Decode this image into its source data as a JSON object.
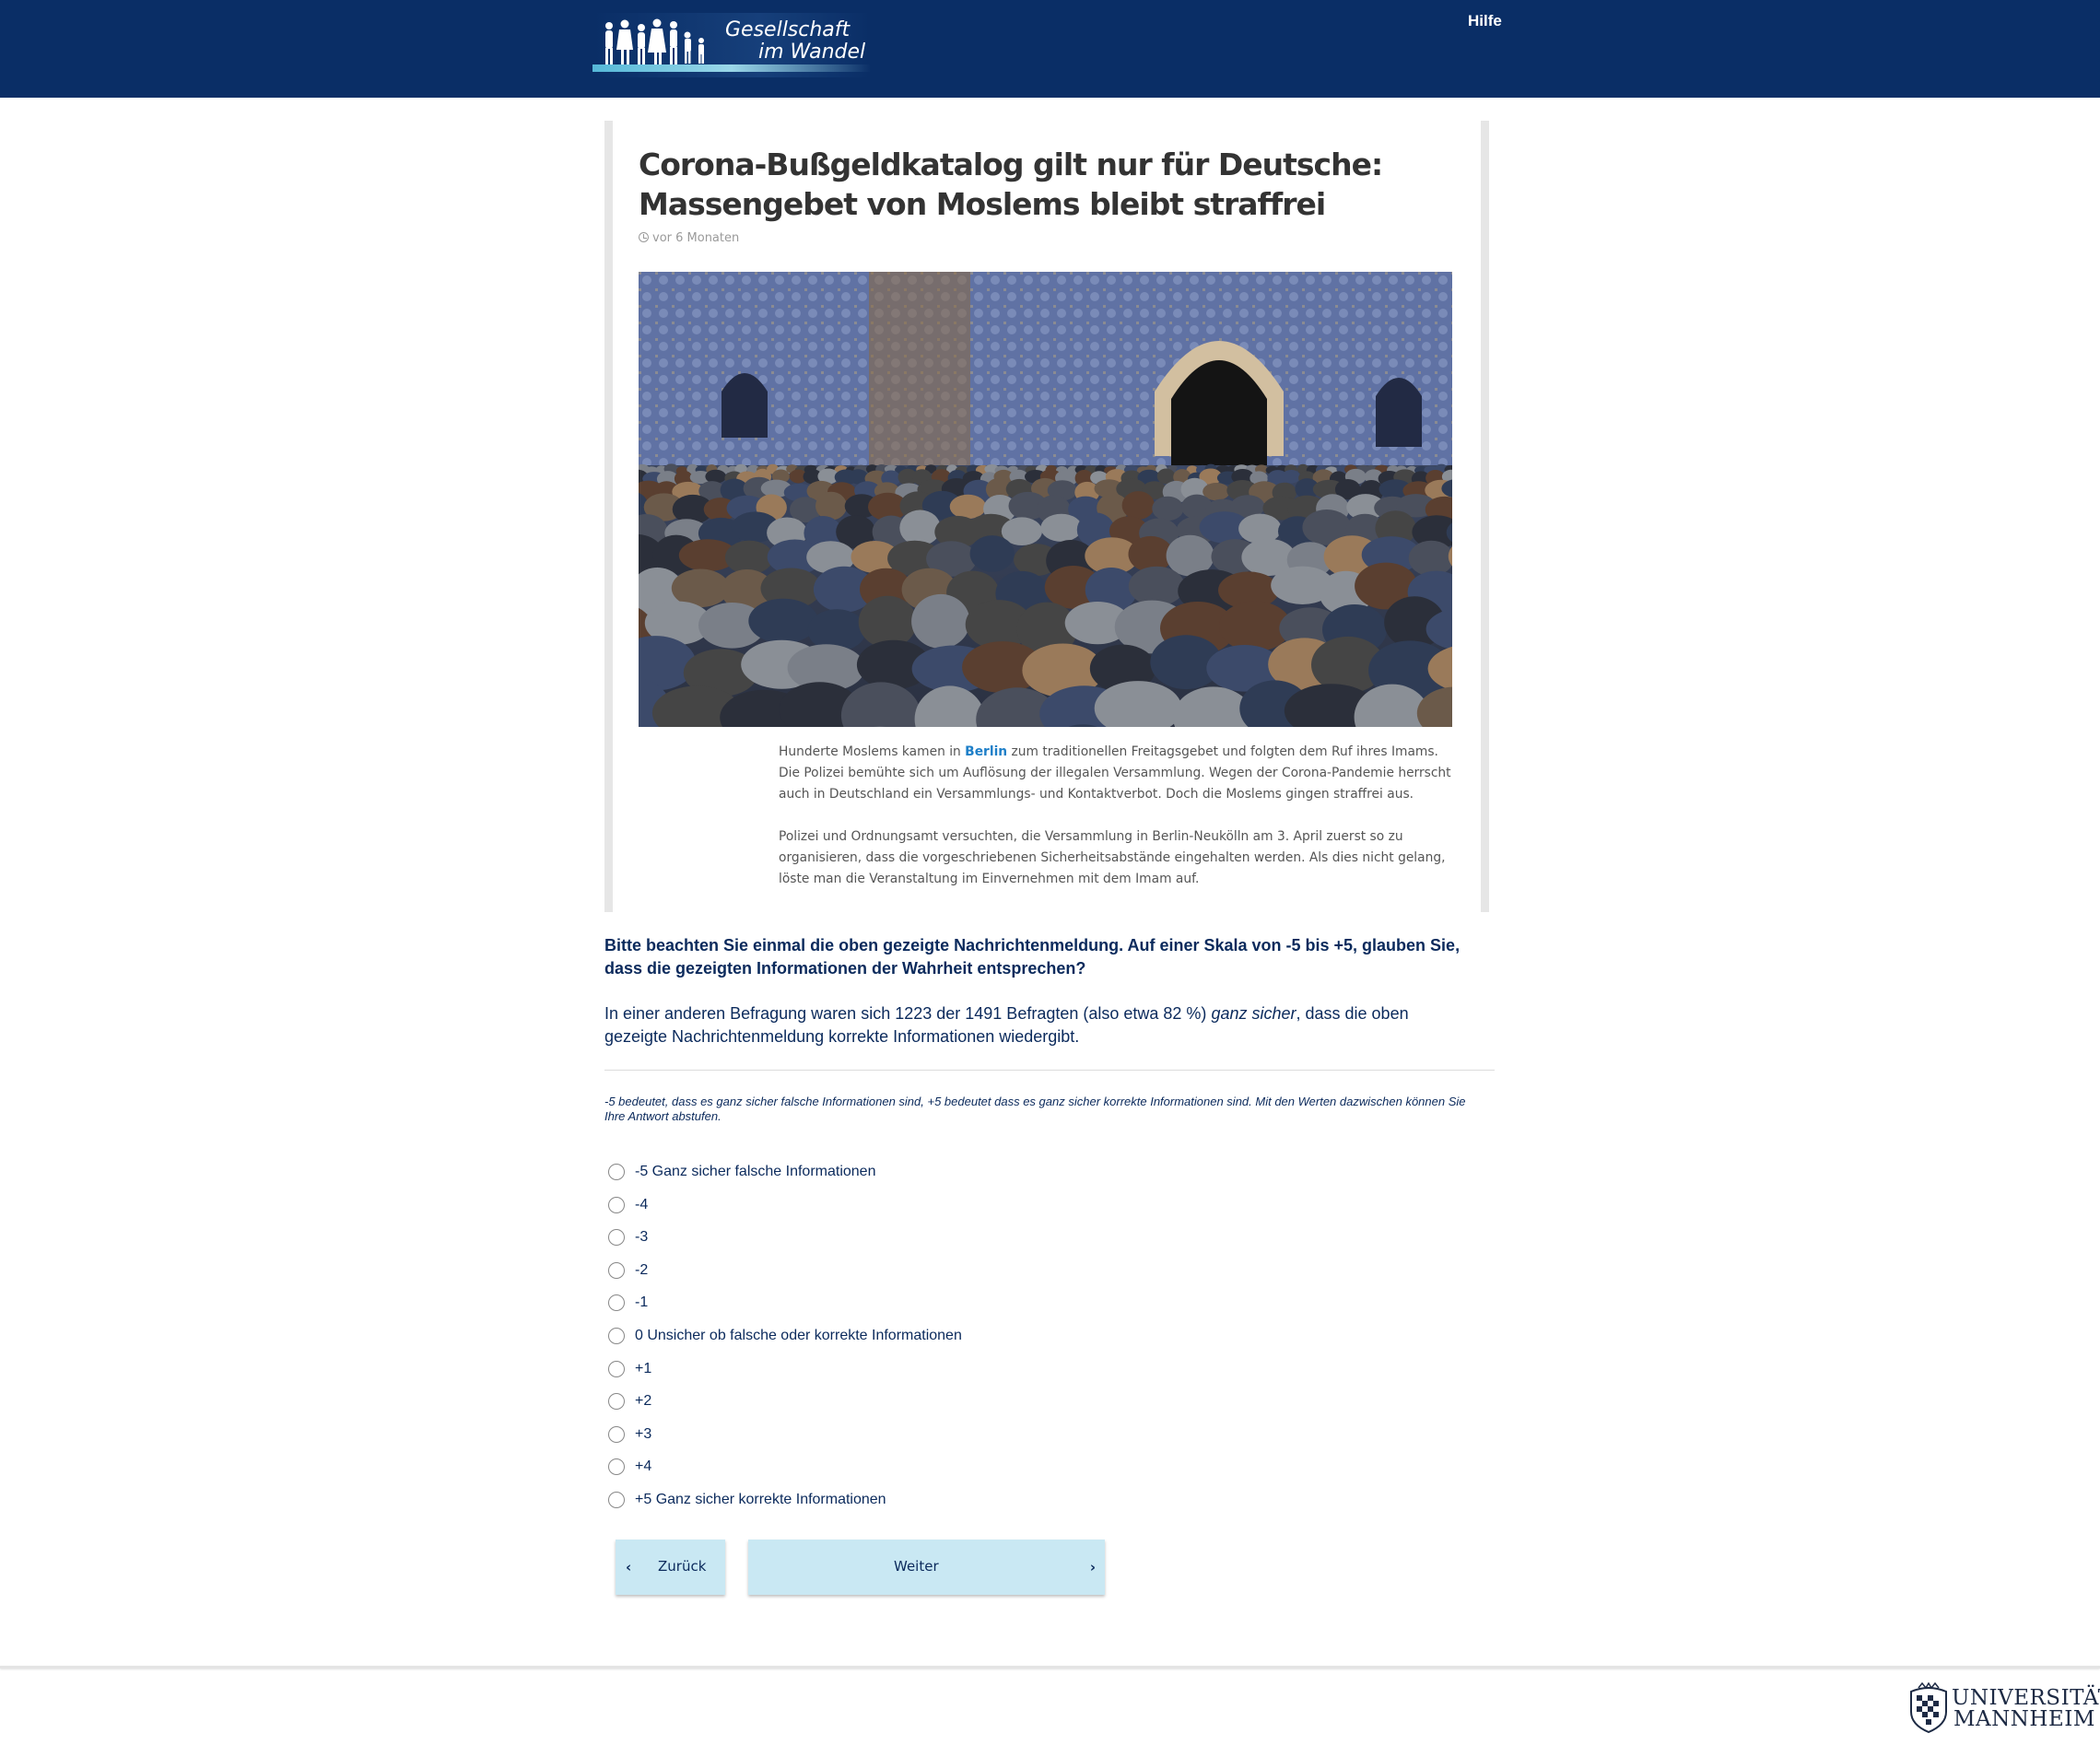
{
  "header": {
    "logo_line1": "Gesellschaft",
    "logo_line2": "im Wandel",
    "help_link": "Hilfe"
  },
  "article": {
    "title_line1": "Corona-Bußgeldkatalog gilt nur für Deutsche:",
    "title_line2": "Massengebet von Moslems bleibt straffrei",
    "date": "vor 6 Monaten",
    "photo_icon": "mass-prayer-mosque-photo",
    "p1_before": "Hunderte Moslems kamen in ",
    "p1_link": "Berlin",
    "p1_after": " zum traditionellen Freitagsgebet und folgten dem Ruf ihres Imams. Die Polizei bemühte sich um Auflösung der illegalen Versammlung. Wegen der Corona-Pandemie herrscht auch in Deutschland ein Versammlungs- und Kontaktverbot. Doch die Moslems gingen straffrei aus.",
    "p2": "Polizei und Ordnungsamt versuchten, die Versammlung in Berlin-Neukölln am 3. April zuerst so zu organisieren, dass die vorgeschriebenen Sicherheitsabstände eingehalten werden. Als dies nicht gelang, löste man die Veranstaltung im Einvernehmen mit dem Imam auf."
  },
  "question": {
    "text": "Bitte beachten Sie einmal die oben gezeigte Nachrichtenmeldung. Auf einer Skala von -5 bis +5, glauben Sie, dass die gezeigten Informationen der Wahrheit entsprechen?",
    "info_before": "In einer anderen Befragung waren sich 1223 der 1491 Befragten (also etwa 82 %) ",
    "info_emph": "ganz sicher",
    "info_after": ", dass die oben gezeigte Nachrichtenmeldung korrekte Informationen wiedergibt.",
    "hint": "-5 bedeutet, dass es ganz sicher falsche Informationen sind, +5 bedeutet dass es ganz sicher korrekte Informationen sind. Mit den Werten dazwischen können Sie Ihre Antwort abstufen."
  },
  "options": [
    {
      "label": "-5 Ganz sicher falsche Informationen"
    },
    {
      "label": "-4"
    },
    {
      "label": "-3"
    },
    {
      "label": "-2"
    },
    {
      "label": "-1"
    },
    {
      "label": "0 Unsicher ob falsche oder korrekte Informationen"
    },
    {
      "label": "+1"
    },
    {
      "label": "+2"
    },
    {
      "label": "+3"
    },
    {
      "label": "+4"
    },
    {
      "label": "+5 Ganz sicher korrekte Informationen"
    }
  ],
  "nav": {
    "back_label": "Zurück",
    "back_icon": "chevron-left-icon",
    "next_label": "Weiter",
    "next_icon": "chevron-right-icon"
  },
  "footer": {
    "uni_line1": "UNIVERSITÄT",
    "uni_line2": "MANNHEIM",
    "seal_icon": "university-seal-icon"
  },
  "colors": {
    "header_bg": "#0a2e66",
    "text": "#0b2a5c",
    "button_bg": "#c9e8f3",
    "link": "#1e7fc8"
  }
}
